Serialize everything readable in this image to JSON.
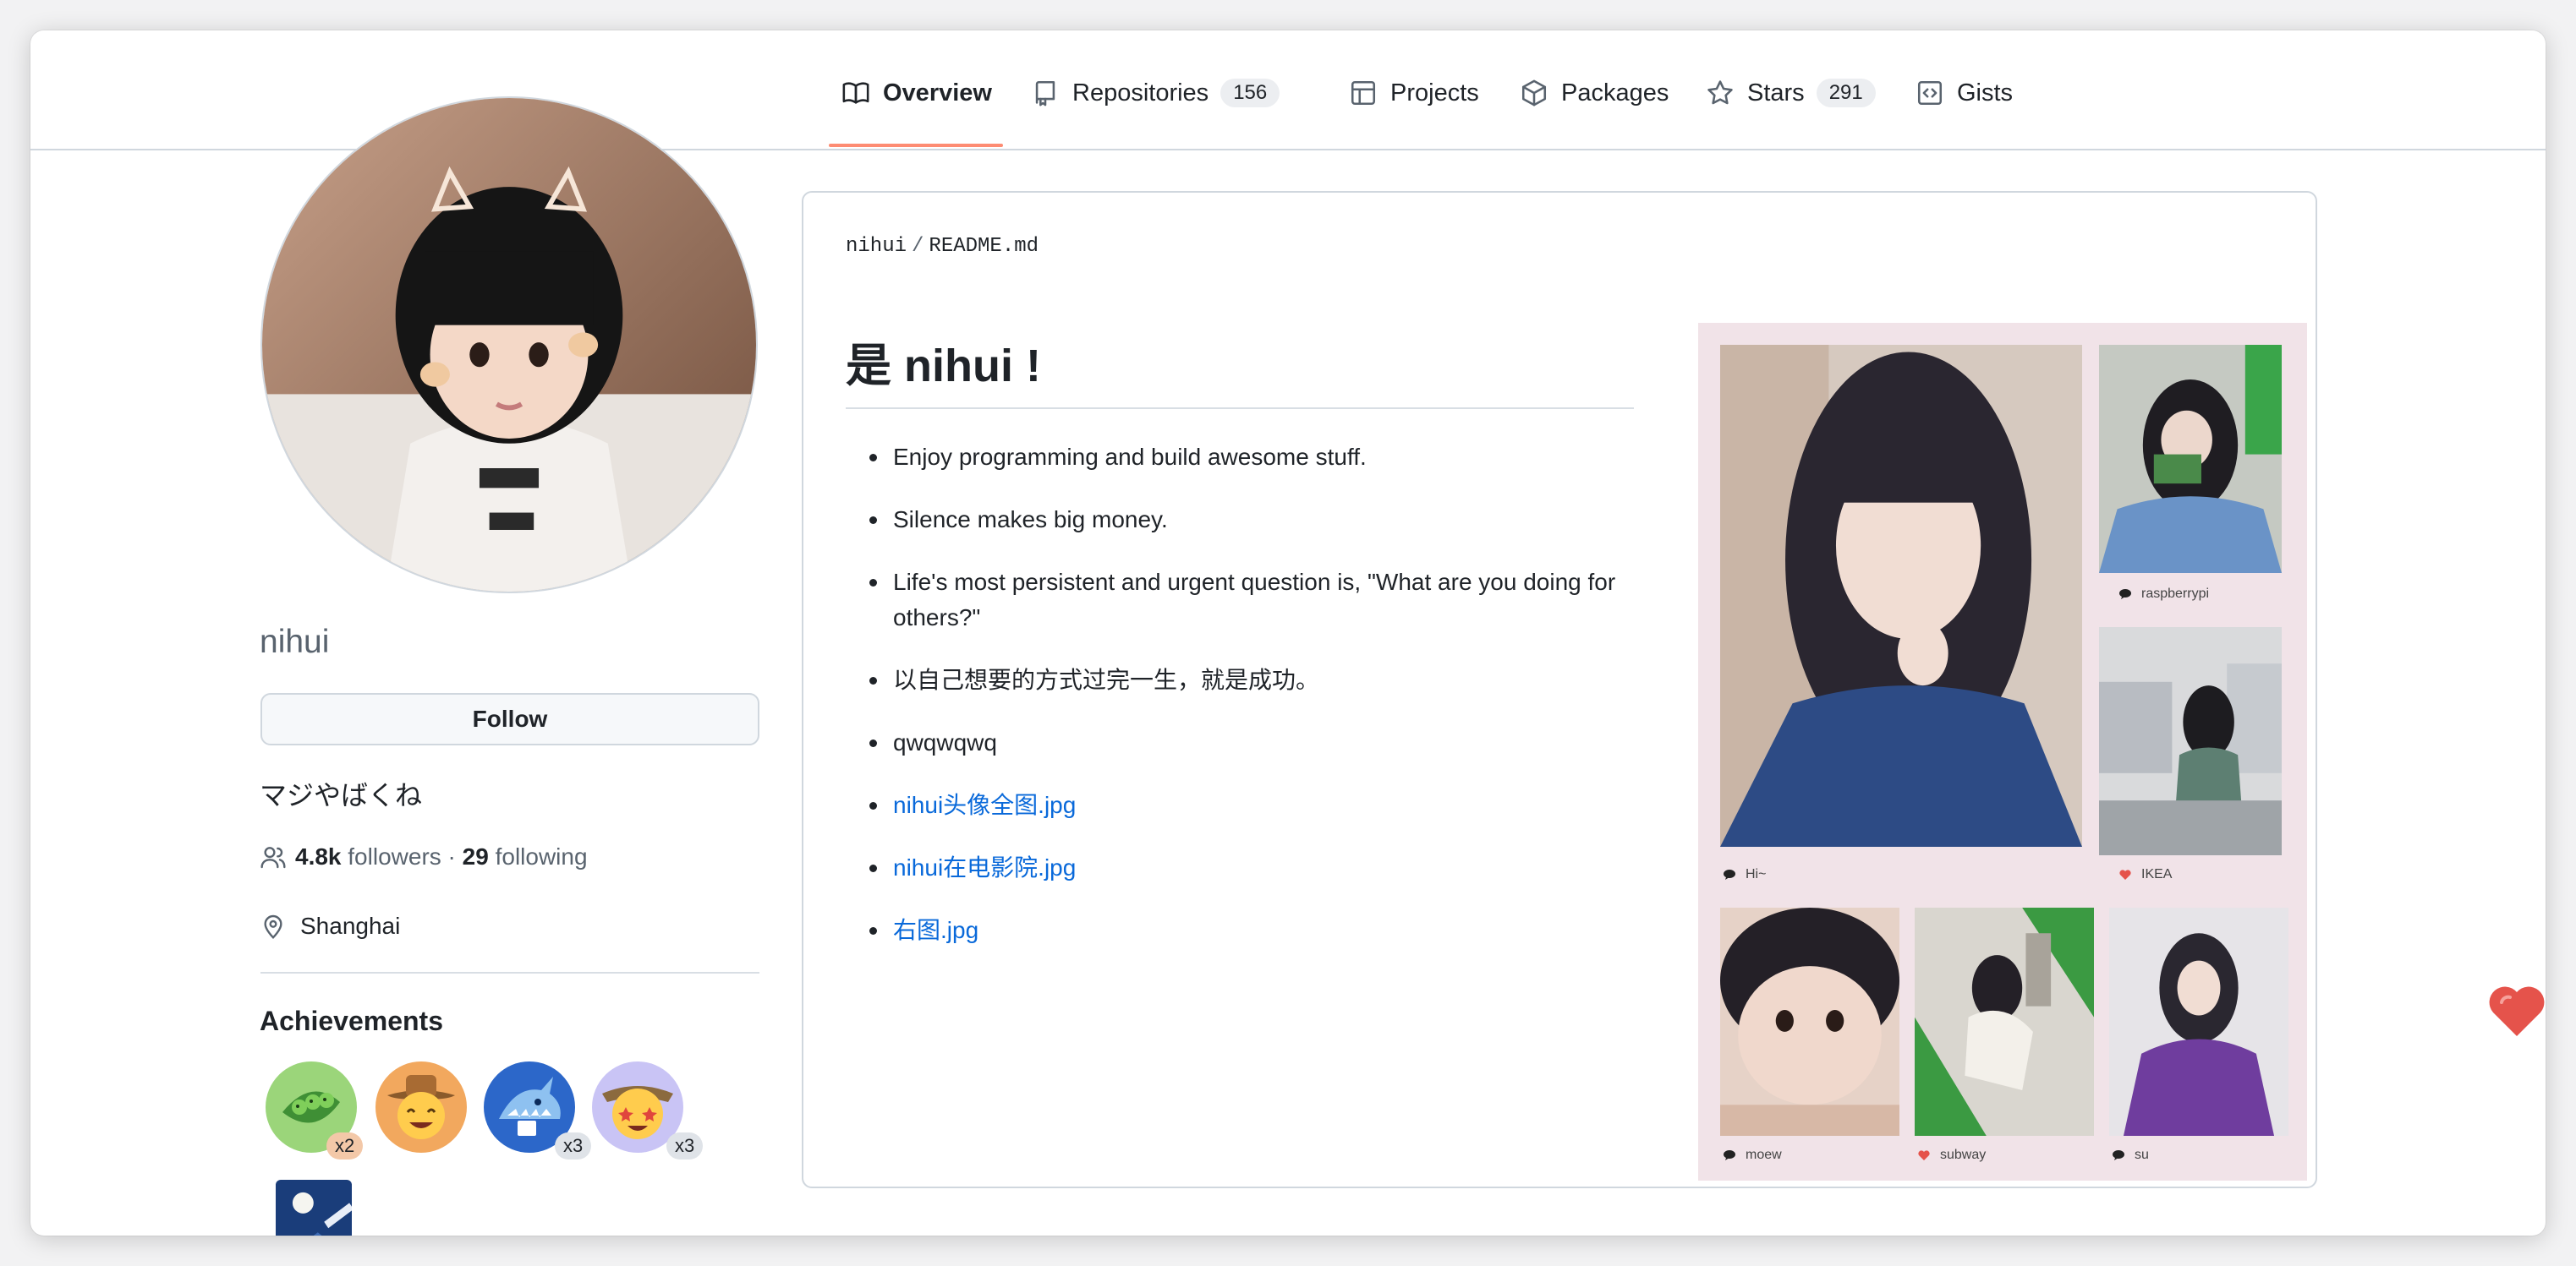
{
  "nav": {
    "tabs": [
      {
        "label": "Overview"
      },
      {
        "label": "Repositories",
        "count": "156"
      },
      {
        "label": "Projects"
      },
      {
        "label": "Packages"
      },
      {
        "label": "Stars",
        "count": "291"
      },
      {
        "label": "Gists"
      }
    ]
  },
  "profile": {
    "username": "nihui",
    "follow_label": "Follow",
    "bio": "マジやばくね",
    "followers_count": "4.8k",
    "followers_label": "followers",
    "separator": "·",
    "following_count": "29",
    "following_label": "following",
    "location": "Shanghai"
  },
  "achievements": {
    "title": "Achievements",
    "badges": [
      {
        "icon": "pea-pod-badge-icon",
        "multiplier": "x2"
      },
      {
        "icon": "cowboy-face-badge-icon",
        "multiplier": ""
      },
      {
        "icon": "shark-badge-icon",
        "multiplier": "x3"
      },
      {
        "icon": "starstruck-face-badge-icon",
        "multiplier": "x3"
      },
      {
        "icon": "moon-night-badge-icon",
        "multiplier": ""
      }
    ]
  },
  "readme": {
    "owner": "nihui",
    "path_separator": "/",
    "file": "README.md",
    "title": "是 nihui !",
    "items": [
      "Enjoy programming and build awesome stuff.",
      "Silence makes big money.",
      "Life's most persistent and urgent question is, \"What are you doing for others?\"",
      "以自己想要的方式过完一生，就是成功。",
      "qwqwqwq"
    ],
    "links": [
      "nihui头像全图.jpg",
      "nihui在电影院.jpg",
      "右图.jpg"
    ],
    "collage": {
      "captions": [
        "raspberrypi",
        "Hi~",
        "IKEA",
        "moew",
        "subway",
        "su"
      ],
      "caption_icons": [
        "speech-bubble-icon",
        "speech-bubble-icon",
        "heart-icon",
        "speech-bubble-icon",
        "heart-icon",
        "speech-bubble-icon"
      ],
      "background": "#f1e3e8"
    }
  },
  "colors": {
    "accent_underline": "#fd8c73",
    "link": "#0969da",
    "heart": "#e5534b"
  }
}
